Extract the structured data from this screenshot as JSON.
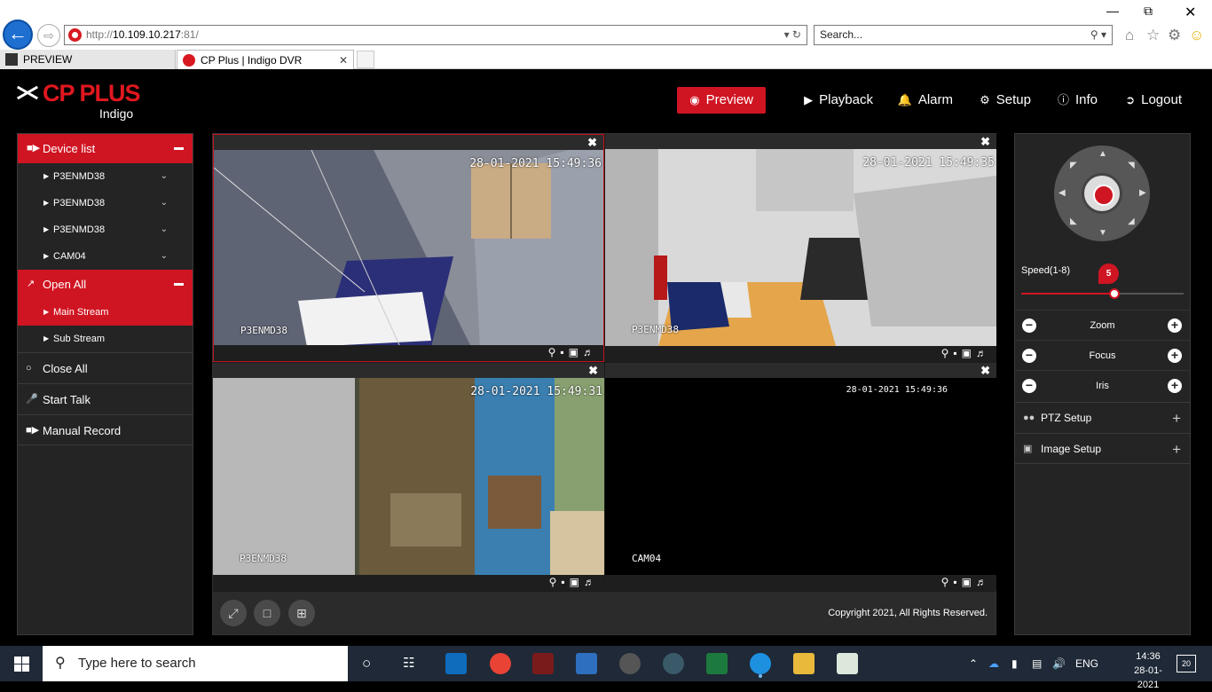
{
  "browser": {
    "url_prefix": "http://",
    "url_host": "10.109.10.217",
    "url_suffix": ":81/",
    "search_placeholder": "Search...",
    "tabs": [
      {
        "label": "PREVIEW"
      },
      {
        "label": "CP Plus | Indigo DVR"
      }
    ]
  },
  "app": {
    "brand": "CP PLUS",
    "sub_brand": "Indigo",
    "nav": [
      {
        "label": "Preview",
        "icon": "eye-icon"
      },
      {
        "label": "Playback",
        "icon": "play-icon"
      },
      {
        "label": "Alarm",
        "icon": "bell-icon"
      },
      {
        "label": "Setup",
        "icon": "gear-icon"
      },
      {
        "label": "Info",
        "icon": "info-icon"
      },
      {
        "label": "Logout",
        "icon": "logout-icon"
      }
    ],
    "accent_color": "#d01522"
  },
  "left_panel": {
    "device_list_label": "Device list",
    "devices": [
      "P3ENMD38",
      "P3ENMD38",
      "P3ENMD38",
      "CAM04"
    ],
    "open_all_label": "Open All",
    "streams": [
      "Main Stream",
      "Sub Stream"
    ],
    "close_all_label": "Close All",
    "start_talk_label": "Start Talk",
    "manual_record_label": "Manual Record"
  },
  "video": {
    "cells": [
      {
        "timestamp": "28-01-2021 15:49:36",
        "camera": "P3ENMD38"
      },
      {
        "timestamp": "28-01-2021 15:49:35",
        "camera": "P3ENMD38"
      },
      {
        "timestamp": "28-01-2021 15:49:31",
        "camera": "P3ENMD38"
      },
      {
        "timestamp": "28-01-2021 15:49:36",
        "camera": "CAM04"
      }
    ],
    "copyright": "Copyright 2021, All Rights Reserved."
  },
  "right_panel": {
    "speed_label": "Speed(1-8)",
    "speed_value": "5",
    "speed_min": 1,
    "speed_max": 8,
    "zoom_label": "Zoom",
    "focus_label": "Focus",
    "iris_label": "Iris",
    "ptz_setup_label": "PTZ Setup",
    "image_setup_label": "Image Setup"
  },
  "taskbar": {
    "search_placeholder": "Type here to search",
    "language": "ENG",
    "time": "14:36",
    "date": "28-01-2021",
    "notifications": "20"
  }
}
